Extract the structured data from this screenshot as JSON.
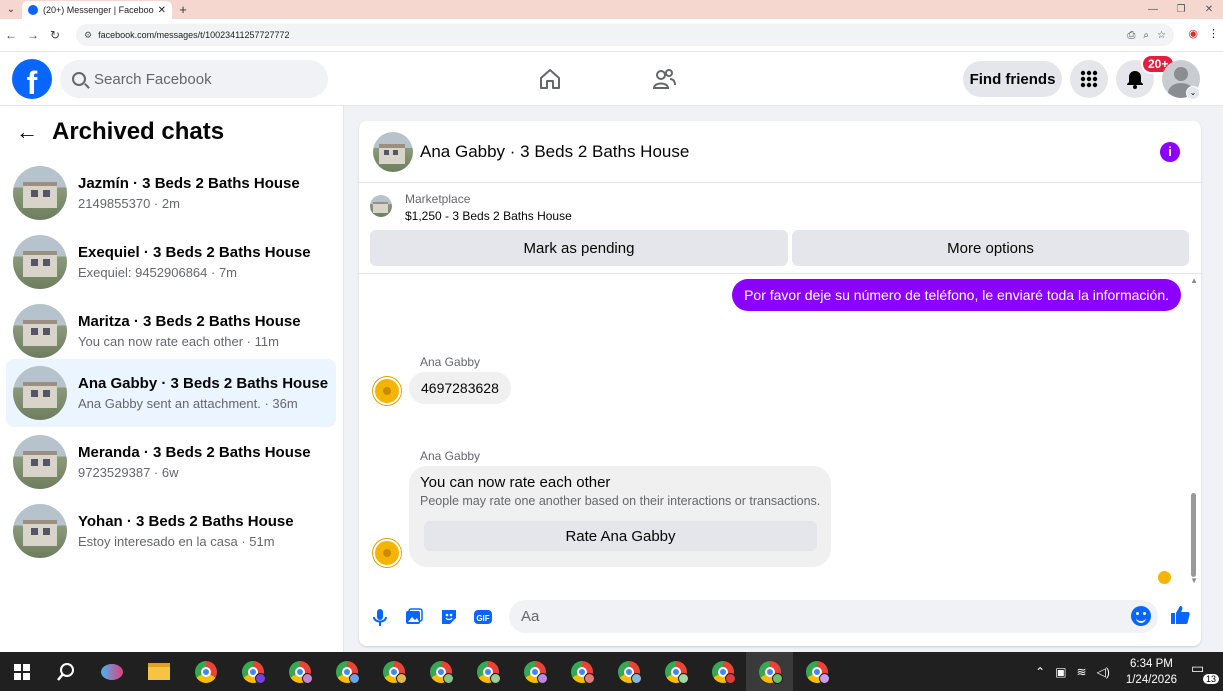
{
  "browser": {
    "tab_title": "(20+) Messenger | Facebook",
    "tab_close": "✕",
    "new_tab": "+",
    "url": "facebook.com/messages/t/10023411257727772"
  },
  "header": {
    "logo": "f",
    "search_placeholder": "Search Facebook",
    "find_friends": "Find friends",
    "notification_badge": "20+"
  },
  "sidebar": {
    "title": "Archived chats",
    "chats": [
      {
        "name": "Jazmín · 3 Beds 2 Baths House",
        "preview": "2149855370 · 2m"
      },
      {
        "name": "Exequiel · 3 Beds 2 Baths House",
        "preview": "Exequiel: 9452906864 · 7m"
      },
      {
        "name": "Maritza · 3 Beds 2 Baths House",
        "preview": "You can now rate each other · 11m"
      },
      {
        "name": "Ana Gabby · 3 Beds 2 Baths House",
        "preview": "Ana Gabby sent an attachment. · 36m"
      },
      {
        "name": "Meranda · 3 Beds 2 Baths House",
        "preview": "9723529387 · 6w"
      },
      {
        "name": "Yohan · 3 Beds 2 Baths House",
        "preview": "Estoy interesado en la casa · 51m"
      }
    ]
  },
  "conversation": {
    "title": "Ana Gabby · 3 Beds 2 Baths House",
    "marketplace_label": "Marketplace",
    "listing": "$1,250 - 3 Beds 2 Baths House",
    "mark_pending": "Mark as pending",
    "more_options": "More options",
    "outgoing_message": "Por favor deje su número de teléfono, le enviaré toda la información.",
    "sender_name_1": "Ana Gabby",
    "incoming_message": "4697283628",
    "sender_name_2": "Ana Gabby",
    "rate_title": "You can now rate each other",
    "rate_desc": "People may rate one another based on their interactions or transactions.",
    "rate_button": "Rate Ana Gabby",
    "composer_placeholder": "Aa"
  },
  "taskbar": {
    "time": "6:34 PM",
    "date": "1/24/2026",
    "notifications": "13"
  }
}
